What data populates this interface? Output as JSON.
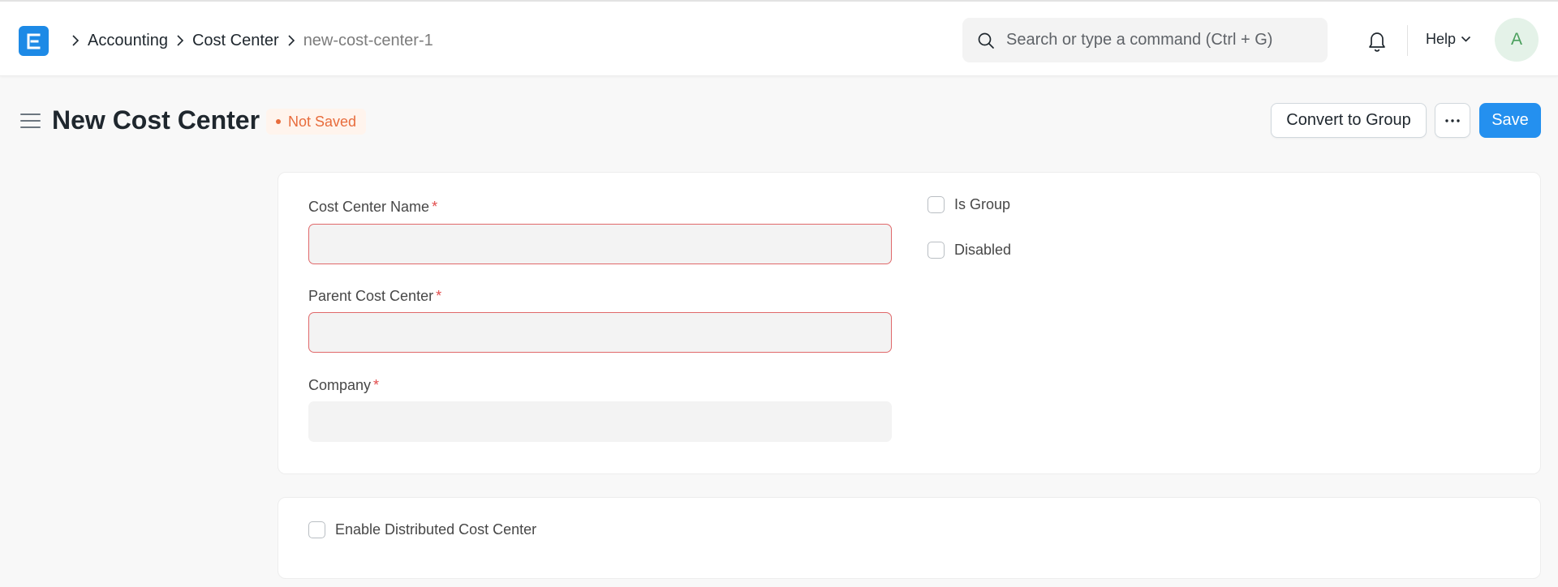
{
  "app": {
    "logo_letter": "E",
    "accent_color": "#2490ef"
  },
  "breadcrumbs": [
    {
      "label": "Accounting"
    },
    {
      "label": "Cost Center"
    },
    {
      "label": "new-cost-center-1"
    }
  ],
  "search": {
    "placeholder": "Search or type a command (Ctrl + G)",
    "icon": "search-icon"
  },
  "navbar": {
    "notifications_icon": "bell-icon",
    "help_label": "Help",
    "avatar_letter": "A"
  },
  "page": {
    "title": "New Cost Center",
    "status": "Not Saved",
    "status_color": "#e86c3c"
  },
  "actions": {
    "convert_label": "Convert to Group",
    "more_label": "···",
    "save_label": "Save"
  },
  "form": {
    "cost_center_name": {
      "label": "Cost Center Name",
      "required": "*",
      "value": ""
    },
    "parent_cost_center": {
      "label": "Parent Cost Center",
      "required": "*",
      "value": ""
    },
    "company": {
      "label": "Company",
      "required": "*",
      "value": ""
    },
    "is_group": {
      "label": "Is Group",
      "checked": false
    },
    "disabled": {
      "label": "Disabled",
      "checked": false
    },
    "enable_distributed": {
      "label": "Enable Distributed Cost Center",
      "checked": false
    }
  }
}
